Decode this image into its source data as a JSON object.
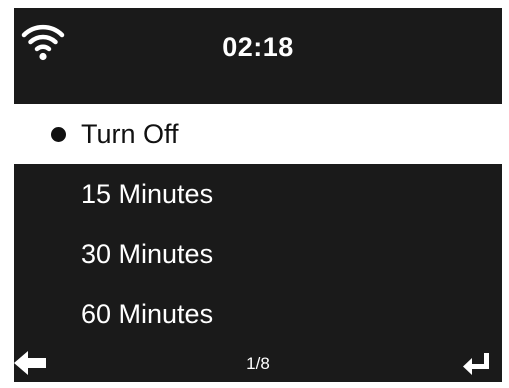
{
  "status_bar": {
    "clock": "02:18",
    "wifi_icon": "wifi-icon"
  },
  "menu": {
    "items": [
      {
        "label": "Turn Off",
        "selected": true
      },
      {
        "label": "15 Minutes",
        "selected": false
      },
      {
        "label": "30 Minutes",
        "selected": false
      },
      {
        "label": "60 Minutes",
        "selected": false
      }
    ]
  },
  "footer": {
    "page_indicator": "1/8",
    "back_icon": "back-arrow-icon",
    "enter_icon": "enter-icon"
  },
  "colors": {
    "background": "#1a1a1a",
    "selection": "#ffffff",
    "text": "#ffffff"
  }
}
